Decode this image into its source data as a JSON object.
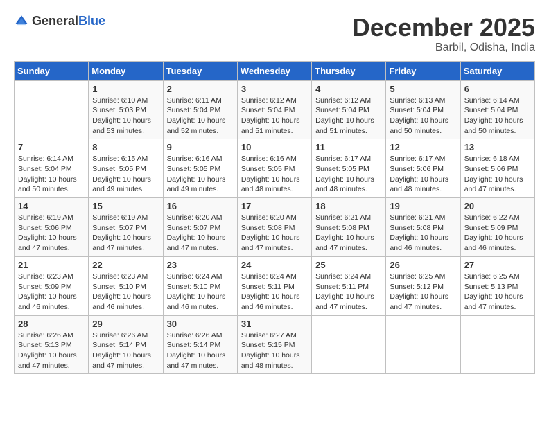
{
  "header": {
    "logo_general": "General",
    "logo_blue": "Blue",
    "month_title": "December 2025",
    "location": "Barbil, Odisha, India"
  },
  "calendar": {
    "days_of_week": [
      "Sunday",
      "Monday",
      "Tuesday",
      "Wednesday",
      "Thursday",
      "Friday",
      "Saturday"
    ],
    "weeks": [
      [
        {
          "date": "",
          "info": ""
        },
        {
          "date": "1",
          "info": "Sunrise: 6:10 AM\nSunset: 5:03 PM\nDaylight: 10 hours\nand 53 minutes."
        },
        {
          "date": "2",
          "info": "Sunrise: 6:11 AM\nSunset: 5:04 PM\nDaylight: 10 hours\nand 52 minutes."
        },
        {
          "date": "3",
          "info": "Sunrise: 6:12 AM\nSunset: 5:04 PM\nDaylight: 10 hours\nand 51 minutes."
        },
        {
          "date": "4",
          "info": "Sunrise: 6:12 AM\nSunset: 5:04 PM\nDaylight: 10 hours\nand 51 minutes."
        },
        {
          "date": "5",
          "info": "Sunrise: 6:13 AM\nSunset: 5:04 PM\nDaylight: 10 hours\nand 50 minutes."
        },
        {
          "date": "6",
          "info": "Sunrise: 6:14 AM\nSunset: 5:04 PM\nDaylight: 10 hours\nand 50 minutes."
        }
      ],
      [
        {
          "date": "7",
          "info": "Sunrise: 6:14 AM\nSunset: 5:04 PM\nDaylight: 10 hours\nand 50 minutes."
        },
        {
          "date": "8",
          "info": "Sunrise: 6:15 AM\nSunset: 5:05 PM\nDaylight: 10 hours\nand 49 minutes."
        },
        {
          "date": "9",
          "info": "Sunrise: 6:16 AM\nSunset: 5:05 PM\nDaylight: 10 hours\nand 49 minutes."
        },
        {
          "date": "10",
          "info": "Sunrise: 6:16 AM\nSunset: 5:05 PM\nDaylight: 10 hours\nand 48 minutes."
        },
        {
          "date": "11",
          "info": "Sunrise: 6:17 AM\nSunset: 5:05 PM\nDaylight: 10 hours\nand 48 minutes."
        },
        {
          "date": "12",
          "info": "Sunrise: 6:17 AM\nSunset: 5:06 PM\nDaylight: 10 hours\nand 48 minutes."
        },
        {
          "date": "13",
          "info": "Sunrise: 6:18 AM\nSunset: 5:06 PM\nDaylight: 10 hours\nand 47 minutes."
        }
      ],
      [
        {
          "date": "14",
          "info": "Sunrise: 6:19 AM\nSunset: 5:06 PM\nDaylight: 10 hours\nand 47 minutes."
        },
        {
          "date": "15",
          "info": "Sunrise: 6:19 AM\nSunset: 5:07 PM\nDaylight: 10 hours\nand 47 minutes."
        },
        {
          "date": "16",
          "info": "Sunrise: 6:20 AM\nSunset: 5:07 PM\nDaylight: 10 hours\nand 47 minutes."
        },
        {
          "date": "17",
          "info": "Sunrise: 6:20 AM\nSunset: 5:08 PM\nDaylight: 10 hours\nand 47 minutes."
        },
        {
          "date": "18",
          "info": "Sunrise: 6:21 AM\nSunset: 5:08 PM\nDaylight: 10 hours\nand 47 minutes."
        },
        {
          "date": "19",
          "info": "Sunrise: 6:21 AM\nSunset: 5:08 PM\nDaylight: 10 hours\nand 46 minutes."
        },
        {
          "date": "20",
          "info": "Sunrise: 6:22 AM\nSunset: 5:09 PM\nDaylight: 10 hours\nand 46 minutes."
        }
      ],
      [
        {
          "date": "21",
          "info": "Sunrise: 6:23 AM\nSunset: 5:09 PM\nDaylight: 10 hours\nand 46 minutes."
        },
        {
          "date": "22",
          "info": "Sunrise: 6:23 AM\nSunset: 5:10 PM\nDaylight: 10 hours\nand 46 minutes."
        },
        {
          "date": "23",
          "info": "Sunrise: 6:24 AM\nSunset: 5:10 PM\nDaylight: 10 hours\nand 46 minutes."
        },
        {
          "date": "24",
          "info": "Sunrise: 6:24 AM\nSunset: 5:11 PM\nDaylight: 10 hours\nand 46 minutes."
        },
        {
          "date": "25",
          "info": "Sunrise: 6:24 AM\nSunset: 5:11 PM\nDaylight: 10 hours\nand 47 minutes."
        },
        {
          "date": "26",
          "info": "Sunrise: 6:25 AM\nSunset: 5:12 PM\nDaylight: 10 hours\nand 47 minutes."
        },
        {
          "date": "27",
          "info": "Sunrise: 6:25 AM\nSunset: 5:13 PM\nDaylight: 10 hours\nand 47 minutes."
        }
      ],
      [
        {
          "date": "28",
          "info": "Sunrise: 6:26 AM\nSunset: 5:13 PM\nDaylight: 10 hours\nand 47 minutes."
        },
        {
          "date": "29",
          "info": "Sunrise: 6:26 AM\nSunset: 5:14 PM\nDaylight: 10 hours\nand 47 minutes."
        },
        {
          "date": "30",
          "info": "Sunrise: 6:26 AM\nSunset: 5:14 PM\nDaylight: 10 hours\nand 47 minutes."
        },
        {
          "date": "31",
          "info": "Sunrise: 6:27 AM\nSunset: 5:15 PM\nDaylight: 10 hours\nand 48 minutes."
        },
        {
          "date": "",
          "info": ""
        },
        {
          "date": "",
          "info": ""
        },
        {
          "date": "",
          "info": ""
        }
      ]
    ]
  }
}
